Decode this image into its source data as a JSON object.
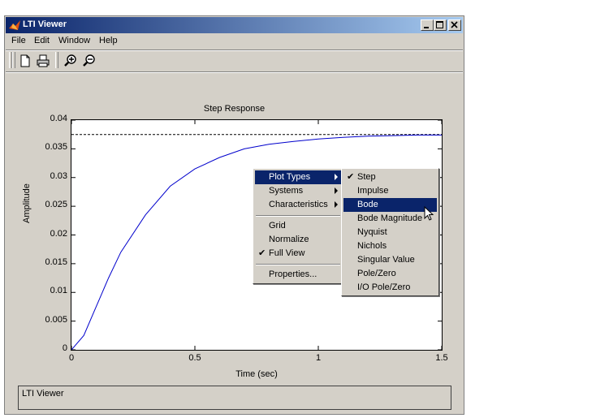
{
  "window": {
    "title": "LTI Viewer"
  },
  "menubar": [
    "File",
    "Edit",
    "Window",
    "Help"
  ],
  "plot": {
    "title": "Step Response",
    "xlabel": "Time (sec)",
    "ylabel": "Amplitude",
    "yticks": [
      "0",
      "0.005",
      "0.01",
      "0.015",
      "0.02",
      "0.025",
      "0.03",
      "0.035",
      "0.04"
    ],
    "xticks": [
      "0",
      "0.5",
      "1",
      "1.5"
    ]
  },
  "chart_data": {
    "type": "line",
    "title": "Step Response",
    "xlabel": "Time (sec)",
    "ylabel": "Amplitude",
    "xlim": [
      0,
      1.5
    ],
    "ylim": [
      0,
      0.04
    ],
    "steady_state": 0.0375,
    "x": [
      0,
      0.05,
      0.1,
      0.15,
      0.2,
      0.3,
      0.4,
      0.5,
      0.6,
      0.7,
      0.8,
      0.9,
      1.0,
      1.1,
      1.2,
      1.3,
      1.4,
      1.5
    ],
    "y": [
      0,
      0.0025,
      0.0075,
      0.0125,
      0.017,
      0.0235,
      0.0285,
      0.0315,
      0.0335,
      0.035,
      0.0358,
      0.0363,
      0.0367,
      0.037,
      0.0372,
      0.0373,
      0.0374,
      0.0374
    ]
  },
  "context_menu": {
    "items": [
      {
        "label": "Plot Types",
        "submenu": true,
        "selected": true
      },
      {
        "label": "Systems",
        "submenu": true
      },
      {
        "label": "Characteristics",
        "submenu": true
      },
      {
        "label": "Grid"
      },
      {
        "label": "Normalize"
      },
      {
        "label": "Full View",
        "checked": true
      },
      {
        "label": "Properties..."
      }
    ],
    "check_glyph": "✔"
  },
  "plot_types_menu": {
    "items": [
      {
        "label": "Step",
        "checked": true
      },
      {
        "label": "Impulse"
      },
      {
        "label": "Bode",
        "selected": true
      },
      {
        "label": "Bode Magnitude"
      },
      {
        "label": "Nyquist"
      },
      {
        "label": "Nichols"
      },
      {
        "label": "Singular Value"
      },
      {
        "label": "Pole/Zero"
      },
      {
        "label": "I/O Pole/Zero"
      }
    ]
  },
  "status": {
    "text": "LTI Viewer"
  },
  "colors": {
    "titlebar": "#0a246a",
    "selection": "#0a246a",
    "curve": "#0000cc"
  },
  "icons": [
    "matlab-icon",
    "new-file-icon",
    "print-icon",
    "zoom-in-icon",
    "zoom-out-icon",
    "minimize-icon",
    "maximize-icon",
    "close-icon",
    "mouse-pointer-icon"
  ]
}
